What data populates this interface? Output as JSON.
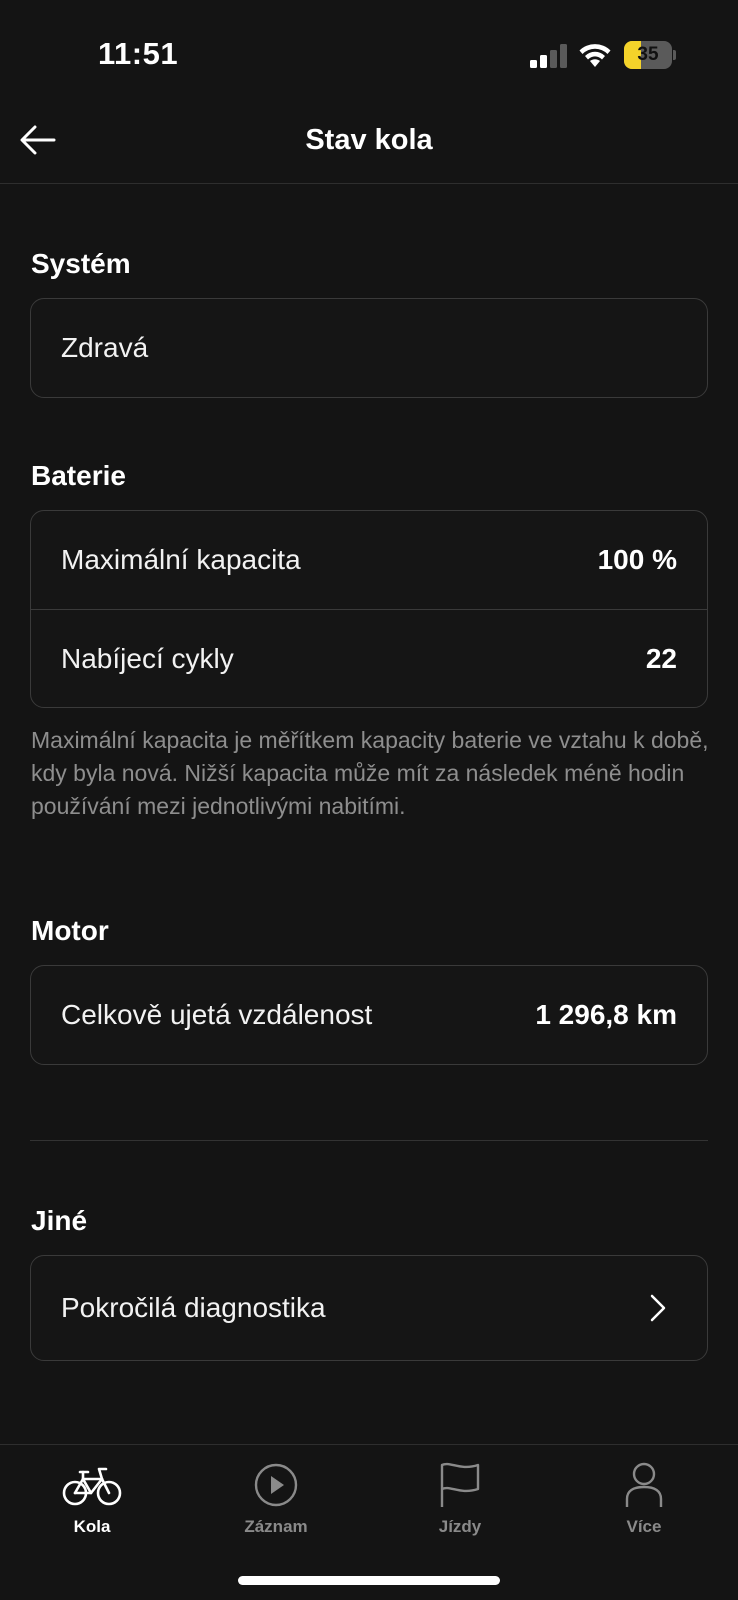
{
  "status_bar": {
    "time": "11:51",
    "battery_level": "35",
    "battery_fraction": 0.35,
    "battery_color": "#f4d32a"
  },
  "header": {
    "title": "Stav kola"
  },
  "system": {
    "title": "Systém",
    "status": "Zdravá"
  },
  "battery": {
    "title": "Baterie",
    "rows": [
      {
        "label": "Maximální kapacita",
        "value": "100 %"
      },
      {
        "label": "Nabíjecí cykly",
        "value": "22"
      }
    ],
    "note": "Maximální kapacita je měřítkem kapacity baterie ve vztahu k době, kdy byla nová. Nižší kapacita může mít za následek méně hodin používání mezi jednotlivými nabitími."
  },
  "motor": {
    "title": "Motor",
    "rows": [
      {
        "label": "Celkově ujetá vzdálenost",
        "value": "1 296,8 km"
      }
    ]
  },
  "other": {
    "title": "Jiné",
    "rows": [
      {
        "label": "Pokročilá diagnostika",
        "icon": "chevron-right-icon"
      }
    ]
  },
  "tab_bar": {
    "tabs": [
      {
        "label": "Kola",
        "icon": "bike-icon",
        "active": true
      },
      {
        "label": "Záznam",
        "icon": "play-circle-icon",
        "active": false
      },
      {
        "label": "Jízdy",
        "icon": "flag-icon",
        "active": false
      },
      {
        "label": "Více",
        "icon": "person-icon",
        "active": false
      }
    ]
  }
}
